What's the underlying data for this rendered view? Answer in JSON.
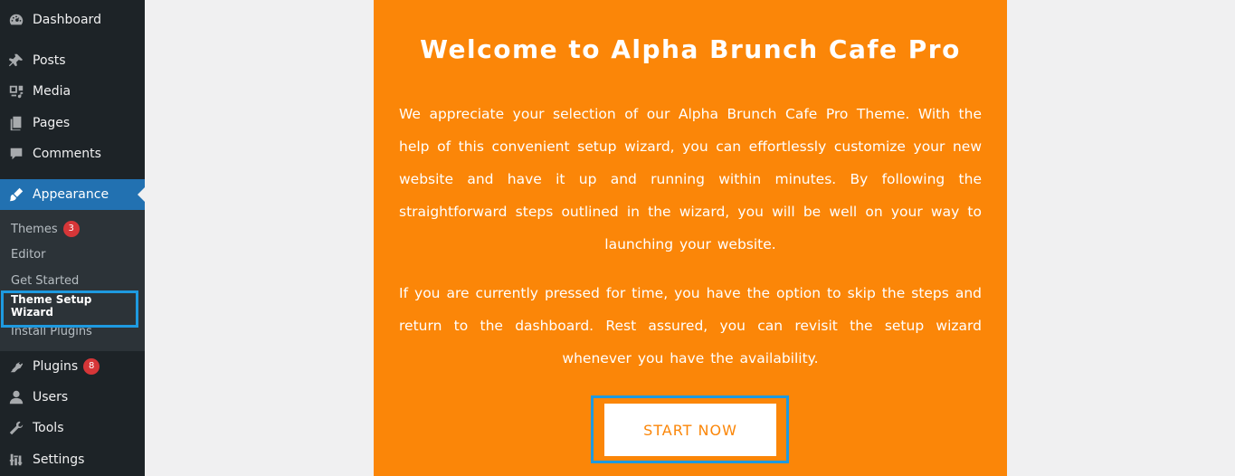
{
  "sidebar": {
    "items": [
      {
        "label": "Dashboard",
        "icon": "dashboard-icon"
      },
      {
        "label": "Posts",
        "icon": "pushpin-icon"
      },
      {
        "label": "Media",
        "icon": "media-icon"
      },
      {
        "label": "Pages",
        "icon": "pages-icon"
      },
      {
        "label": "Comments",
        "icon": "comments-icon"
      },
      {
        "label": "Appearance",
        "icon": "paintbrush-icon"
      },
      {
        "label": "Plugins",
        "icon": "plugins-icon",
        "badge": "8"
      },
      {
        "label": "Users",
        "icon": "users-icon"
      },
      {
        "label": "Tools",
        "icon": "wrench-icon"
      },
      {
        "label": "Settings",
        "icon": "settings-icon"
      }
    ],
    "submenu": [
      {
        "label": "Themes",
        "badge": "3"
      },
      {
        "label": "Editor"
      },
      {
        "label": "Get Started"
      },
      {
        "label": "Theme Setup Wizard"
      },
      {
        "label": "Install Plugins"
      }
    ]
  },
  "main": {
    "title": "Welcome to Alpha Brunch Cafe Pro",
    "paragraph1": "We appreciate your selection of our Alpha Brunch Cafe Pro Theme. With the help of this convenient setup wizard, you can effortlessly customize your new website and have it up and running within minutes. By following the straightforward steps outlined in the wizard, you will be well on your way to launching your website.",
    "paragraph2": "If you are currently pressed for time, you have the option to skip the steps and return to the dashboard. Rest assured, you can revisit the setup wizard whenever you have the availability.",
    "start_button": "START NOW"
  },
  "colors": {
    "sidebar_bg": "#1d2327",
    "submenu_bg": "#2c3338",
    "active_blue": "#2271b1",
    "accent_orange": "#fb8608",
    "highlight_blue": "#1e9ae0",
    "badge_red": "#d63638"
  }
}
